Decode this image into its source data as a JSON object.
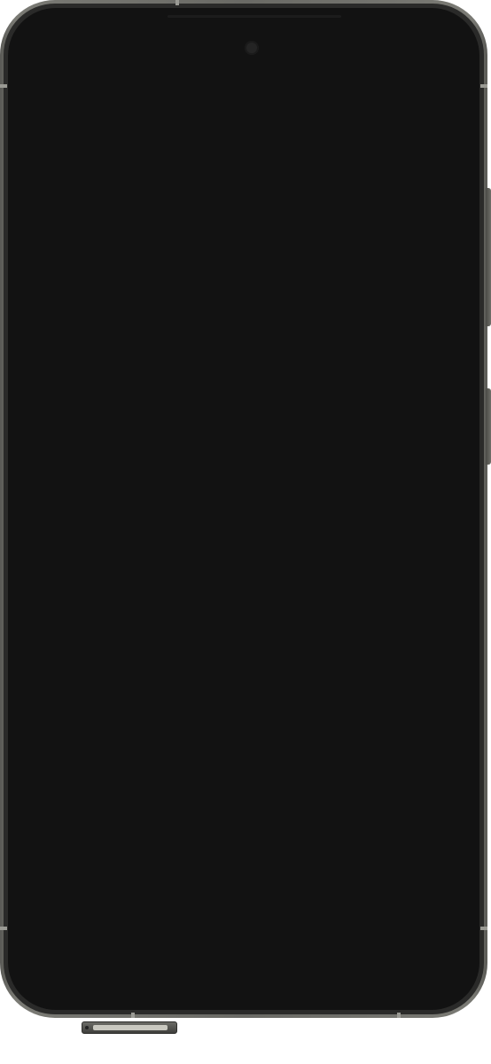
{
  "device": {
    "type": "smartphone",
    "screen_state": "off",
    "colors": {
      "frame": "#6a6a65",
      "bezel": "#2a2a29",
      "screen": "#121212",
      "camera": "#242424"
    },
    "icons": [
      "front-camera",
      "volume-button",
      "power-button",
      "sim-tray"
    ]
  }
}
